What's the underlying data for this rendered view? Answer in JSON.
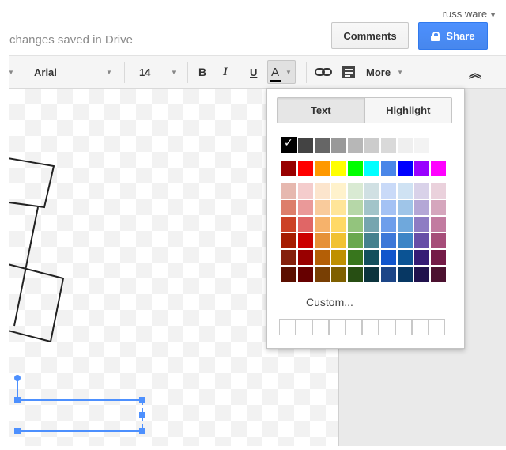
{
  "header": {
    "user_name": "russ ware",
    "save_status": "changes saved in Drive",
    "comments_label": "Comments",
    "share_label": "Share"
  },
  "toolbar": {
    "font": "Arial",
    "font_size": "14",
    "bold_label": "B",
    "italic_label": "I",
    "underline_label": "U",
    "text_color_label": "A",
    "more_label": "More",
    "collapse_icon": "double-chevron-up-icon"
  },
  "color_picker": {
    "tab_text": "Text",
    "tab_highlight": "Highlight",
    "selected_color": "#000000",
    "custom_label": "Custom...",
    "rows": [
      [
        "#000000",
        "#434343",
        "#666666",
        "#999999",
        "#b7b7b7",
        "#cccccc",
        "#d9d9d9",
        "#efefef",
        "#f3f3f3",
        "#ffffff"
      ],
      [
        "#980000",
        "#ff0000",
        "#ff9900",
        "#ffff00",
        "#00ff00",
        "#00ffff",
        "#4a86e8",
        "#0000ff",
        "#9900ff",
        "#ff00ff"
      ],
      [
        "#e6b8af",
        "#f4cccc",
        "#fce5cd",
        "#fff2cc",
        "#d9ead3",
        "#d0e0e3",
        "#c9daf8",
        "#cfe2f3",
        "#d9d2e9",
        "#ead1dc"
      ],
      [
        "#dd7e6b",
        "#ea9999",
        "#f9cb9c",
        "#ffe599",
        "#b6d7a8",
        "#a2c4c9",
        "#a4c2f4",
        "#9fc5e8",
        "#b4a7d6",
        "#d5a6bd"
      ],
      [
        "#cc4125",
        "#e06666",
        "#f6b26b",
        "#ffd966",
        "#93c47d",
        "#76a5af",
        "#6d9eeb",
        "#6fa8dc",
        "#8e7cc3",
        "#c27ba0"
      ],
      [
        "#a61c00",
        "#cc0000",
        "#e69138",
        "#f1c232",
        "#6aa84f",
        "#45818e",
        "#3c78d8",
        "#3d85c6",
        "#674ea7",
        "#a64d79"
      ],
      [
        "#85200c",
        "#990000",
        "#b45f06",
        "#bf9000",
        "#38761d",
        "#134f5c",
        "#1155cc",
        "#0b5394",
        "#351c75",
        "#741b47"
      ],
      [
        "#5b0f00",
        "#660000",
        "#783f04",
        "#7f6000",
        "#274e13",
        "#0c343d",
        "#1c4587",
        "#073763",
        "#20124d",
        "#4c1130"
      ]
    ]
  }
}
